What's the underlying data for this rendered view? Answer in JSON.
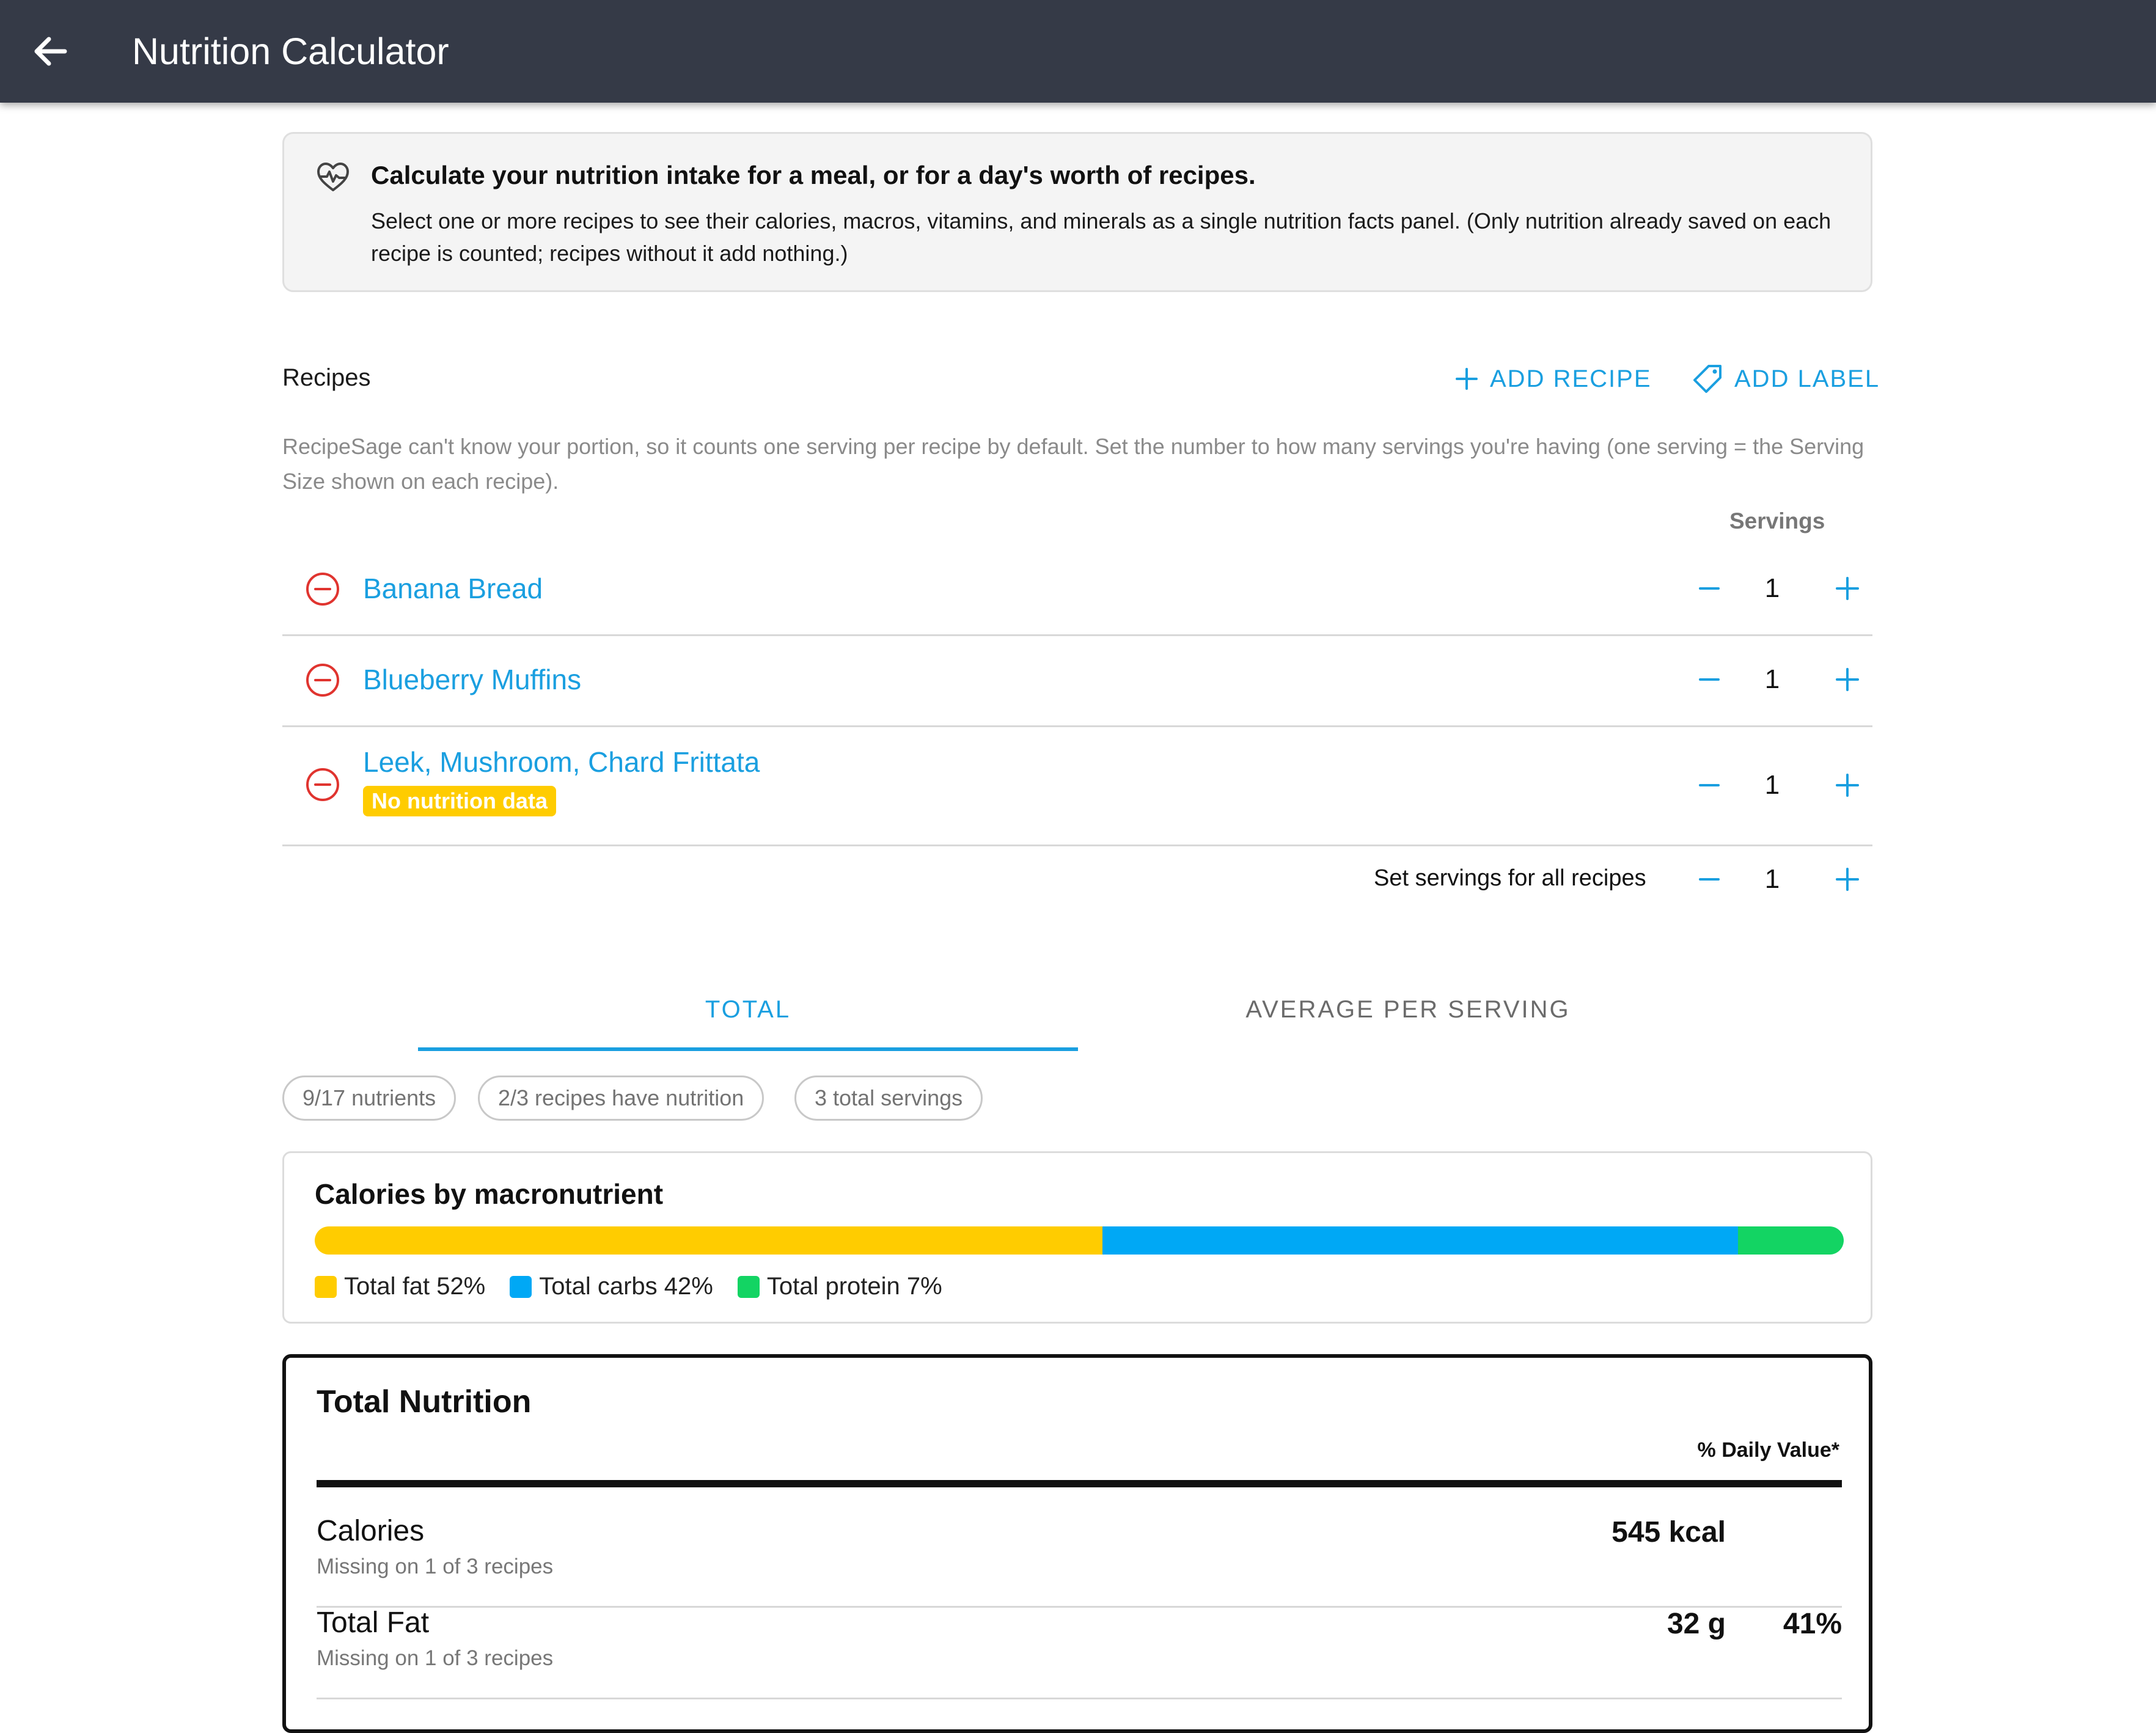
{
  "header": {
    "title": "Nutrition Calculator",
    "back_icon": "arrow-left-icon"
  },
  "info": {
    "heading": "Calculate your nutrition intake for a meal, or for a day's worth of recipes.",
    "body": "Select one or more recipes to see their calories, macros, vitamins, and minerals as a single nutrition facts panel. (Only nutrition already saved on each recipe is counted; recipes without it add nothing.)",
    "icon": "heart-pulse-icon"
  },
  "recipes_section": {
    "label": "Recipes",
    "add_recipe": "ADD RECIPE",
    "add_label": "ADD LABEL",
    "hint": "RecipeSage can't know your portion, so it counts one serving per recipe by default. Set the number to how many servings you're having (one serving = the Serving Size shown on each recipe).",
    "servings_header": "Servings",
    "items": [
      {
        "name": "Banana Bread",
        "servings": "1",
        "badge": ""
      },
      {
        "name": "Blueberry Muffins",
        "servings": "1",
        "badge": ""
      },
      {
        "name": "Leek, Mushroom, Chard Frittata",
        "servings": "1",
        "badge": "No nutrition data"
      }
    ],
    "all": {
      "label": "Set servings for all recipes",
      "servings": "1"
    }
  },
  "tabs": [
    {
      "label": "TOTAL",
      "selected": true
    },
    {
      "label": "AVERAGE PER SERVING",
      "selected": false
    }
  ],
  "chips": [
    "9/17 nutrients",
    "2/3 recipes have nutrition",
    "3 total servings"
  ],
  "macros": {
    "title": "Calories by macronutrient",
    "items": [
      {
        "label": "Total fat 52%",
        "percent": 51.5,
        "color": "#ffcc00"
      },
      {
        "label": "Total carbs 42%",
        "percent": 41.6,
        "color": "#00a8f5"
      },
      {
        "label": "Total protein 7%",
        "percent": 6.9,
        "color": "#13d463"
      }
    ]
  },
  "facts": {
    "title": "Total Nutrition",
    "dv_header": "% Daily Value*",
    "rows": [
      {
        "name": "Calories",
        "missing": "Missing on 1 of 3 recipes",
        "amount": "545 kcal",
        "dv": ""
      },
      {
        "name": "Total Fat",
        "missing": "Missing on 1 of 3 recipes",
        "amount": "32 g",
        "dv": "41%"
      }
    ]
  }
}
